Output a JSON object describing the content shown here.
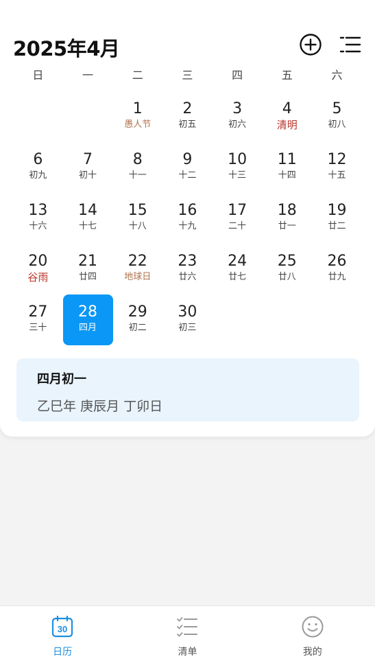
{
  "header": {
    "title": "2025年4月"
  },
  "colors": {
    "accent": "#0b97f5",
    "festival": "#b0704d",
    "solar_term": "#b8352a"
  },
  "weekdays": [
    "日",
    "一",
    "二",
    "三",
    "四",
    "五",
    "六"
  ],
  "calendar": {
    "rows": [
      [
        {
          "day": "",
          "lunar": ""
        },
        {
          "day": "",
          "lunar": ""
        },
        {
          "day": "1",
          "lunar": "愚人节",
          "kind": "festival"
        },
        {
          "day": "2",
          "lunar": "初五"
        },
        {
          "day": "3",
          "lunar": "初六"
        },
        {
          "day": "4",
          "lunar": "清明",
          "kind": "term"
        },
        {
          "day": "5",
          "lunar": "初八"
        }
      ],
      [
        {
          "day": "6",
          "lunar": "初九"
        },
        {
          "day": "7",
          "lunar": "初十"
        },
        {
          "day": "8",
          "lunar": "十一"
        },
        {
          "day": "9",
          "lunar": "十二"
        },
        {
          "day": "10",
          "lunar": "十三"
        },
        {
          "day": "11",
          "lunar": "十四"
        },
        {
          "day": "12",
          "lunar": "十五"
        }
      ],
      [
        {
          "day": "13",
          "lunar": "十六"
        },
        {
          "day": "14",
          "lunar": "十七"
        },
        {
          "day": "15",
          "lunar": "十八"
        },
        {
          "day": "16",
          "lunar": "十九"
        },
        {
          "day": "17",
          "lunar": "二十"
        },
        {
          "day": "18",
          "lunar": "廿一"
        },
        {
          "day": "19",
          "lunar": "廿二"
        }
      ],
      [
        {
          "day": "20",
          "lunar": "谷雨",
          "kind": "term"
        },
        {
          "day": "21",
          "lunar": "廿四"
        },
        {
          "day": "22",
          "lunar": "地球日",
          "kind": "festival"
        },
        {
          "day": "23",
          "lunar": "廿六"
        },
        {
          "day": "24",
          "lunar": "廿七"
        },
        {
          "day": "25",
          "lunar": "廿八"
        },
        {
          "day": "26",
          "lunar": "廿九"
        }
      ],
      [
        {
          "day": "27",
          "lunar": "三十"
        },
        {
          "day": "28",
          "lunar": "四月",
          "selected": true
        },
        {
          "day": "29",
          "lunar": "初二"
        },
        {
          "day": "30",
          "lunar": "初三"
        },
        {
          "day": "",
          "lunar": ""
        },
        {
          "day": "",
          "lunar": ""
        },
        {
          "day": "",
          "lunar": ""
        }
      ]
    ]
  },
  "info": {
    "lunar_date": "四月初一",
    "ganzhi": "乙巳年 庚辰月 丁卯日"
  },
  "tabbar": {
    "items": [
      {
        "label": "日历",
        "icon": "calendar-icon",
        "icon_text": "30",
        "active": true
      },
      {
        "label": "清单",
        "icon": "checklist-icon"
      },
      {
        "label": "我的",
        "icon": "smiley-icon"
      }
    ]
  }
}
